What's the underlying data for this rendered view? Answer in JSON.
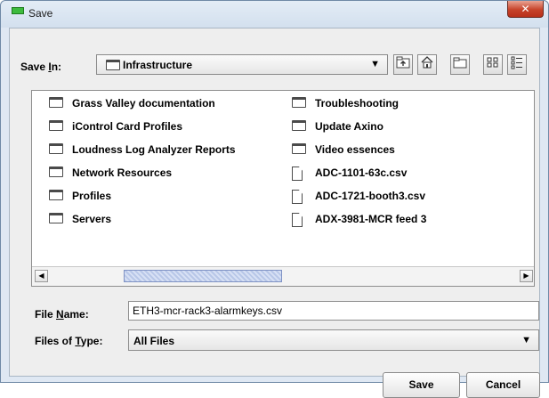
{
  "window": {
    "title": "Save",
    "close_glyph": "✕"
  },
  "save_in": {
    "label_prefix": "Save ",
    "label_mnemonic": "I",
    "label_suffix": "n:",
    "value": "Infrastructure"
  },
  "toolbar": {
    "up_icon": "up-folder-icon",
    "home_icon": "home-icon",
    "new_folder_icon": "new-folder-icon",
    "list_view_icon": "list-view-icon",
    "details_view_icon": "details-view-icon"
  },
  "files": {
    "column1": [
      {
        "type": "folder",
        "name": "Grass Valley documentation"
      },
      {
        "type": "folder",
        "name": "iControl Card Profiles"
      },
      {
        "type": "folder",
        "name": "Loudness Log Analyzer Reports"
      },
      {
        "type": "folder",
        "name": "Network Resources"
      },
      {
        "type": "folder",
        "name": "Profiles"
      },
      {
        "type": "folder",
        "name": "Servers"
      }
    ],
    "column2": [
      {
        "type": "folder",
        "name": "Troubleshooting"
      },
      {
        "type": "folder",
        "name": "Update Axino"
      },
      {
        "type": "folder",
        "name": "Video essences"
      },
      {
        "type": "file",
        "name": "ADC-1101-63c.csv"
      },
      {
        "type": "file",
        "name": "ADC-1721-booth3.csv"
      },
      {
        "type": "file",
        "name": "ADX-3981-MCR feed 3"
      }
    ]
  },
  "file_name": {
    "label_prefix": "File ",
    "label_mnemonic": "N",
    "label_suffix": "ame:",
    "value": "ETH3-mcr-rack3-alarmkeys.csv"
  },
  "file_type": {
    "label_prefix": "Files of ",
    "label_mnemonic": "T",
    "label_suffix": "ype:",
    "value": "All Files"
  },
  "buttons": {
    "save": "Save",
    "cancel": "Cancel"
  },
  "colors": {
    "title_accent": "#3dbb3d",
    "close_red": "#c7432a",
    "scroll_thumb": "#b8c7e8"
  }
}
